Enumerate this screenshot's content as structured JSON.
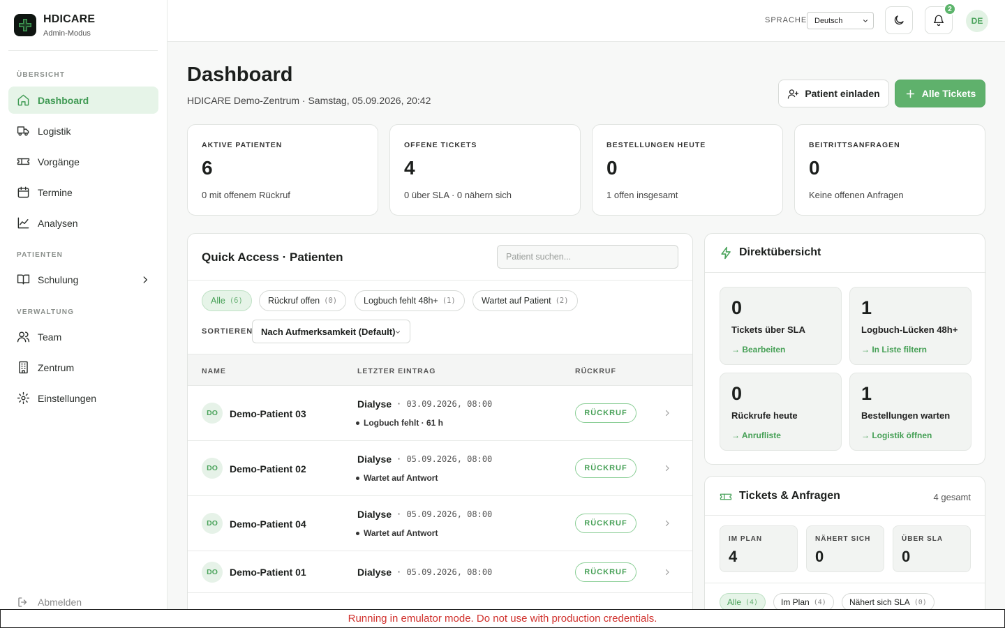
{
  "brand": {
    "title": "HDICARE",
    "subtitle": "Admin-Modus"
  },
  "sidebar": {
    "sections": [
      "ÜBERSICHT",
      "PATIENTEN",
      "VERWALTUNG"
    ],
    "items": [
      {
        "label": "Dashboard",
        "icon": "home-icon",
        "active": true
      },
      {
        "label": "Logistik",
        "icon": "truck-icon"
      },
      {
        "label": "Vorgänge",
        "icon": "ticket-icon"
      },
      {
        "label": "Termine",
        "icon": "calendar-icon"
      },
      {
        "label": "Analysen",
        "icon": "chart-line-icon"
      },
      {
        "label": "Schulung",
        "icon": "book-icon"
      },
      {
        "label": "Team",
        "icon": "users-icon"
      },
      {
        "label": "Zentrum",
        "icon": "building-icon"
      },
      {
        "label": "Einstellungen",
        "icon": "gear-icon"
      }
    ],
    "logout": "Abmelden"
  },
  "topbar": {
    "language_label": "SPRACHE",
    "language_value": "Deutsch",
    "notifications_count": "2",
    "avatar": "DE"
  },
  "header": {
    "title": "Dashboard",
    "subtitle": "HDICARE Demo-Zentrum · Samstag, 05.09.2026, 20:42",
    "invite_label": "Patient einladen",
    "all_tickets_label": "Alle Tickets"
  },
  "stats": [
    {
      "label": "AKTIVE PATIENTEN",
      "value": "6",
      "hint": "0 mit offenem Rückruf"
    },
    {
      "label": "OFFENE TICKETS",
      "value": "4",
      "hint": "0 über SLA · 0 nähern sich"
    },
    {
      "label": "BESTELLUNGEN HEUTE",
      "value": "0",
      "hint": "1 offen insgesamt"
    },
    {
      "label": "BEITRITTSANFRAGEN",
      "value": "0",
      "hint": "Keine offenen Anfragen"
    }
  ],
  "quick_access": {
    "title": "Quick Access · Patienten",
    "search_placeholder": "Patient suchen...",
    "filters": [
      {
        "label": "Alle",
        "count": "(6)"
      },
      {
        "label": "Rückruf offen",
        "count": "(0)"
      },
      {
        "label": "Logbuch fehlt 48h+",
        "count": "(1)"
      },
      {
        "label": "Wartet auf Patient",
        "count": "(2)"
      }
    ],
    "sort_label": "SORTIEREN",
    "sort_value": "Nach Aufmerksamkeit (Default)",
    "columns": [
      "NAME",
      "LETZTER EINTRAG",
      "RÜCKRUF"
    ],
    "rows": [
      {
        "initials": "DO",
        "name": "Demo-Patient 03",
        "type": "Dialyse",
        "date": "· 03.09.2026, 08:00",
        "status": "Logbuch fehlt · 61 h",
        "action": "RÜCKRUF"
      },
      {
        "initials": "DO",
        "name": "Demo-Patient 02",
        "type": "Dialyse",
        "date": "· 05.09.2026, 08:00",
        "status": "Wartet auf Antwort",
        "action": "RÜCKRUF"
      },
      {
        "initials": "DO",
        "name": "Demo-Patient 04",
        "type": "Dialyse",
        "date": "· 05.09.2026, 08:00",
        "status": "Wartet auf Antwort",
        "action": "RÜCKRUF"
      },
      {
        "initials": "DO",
        "name": "Demo-Patient 01",
        "type": "Dialyse",
        "date": "· 05.09.2026, 08:00",
        "status": "",
        "action": "RÜCKRUF"
      }
    ]
  },
  "direct": {
    "title": "Direktübersicht",
    "tiles": [
      {
        "value": "0",
        "label": "Tickets über SLA",
        "action": "→ Bearbeiten"
      },
      {
        "value": "1",
        "label": "Logbuch-Lücken 48h+",
        "action": "→ In Liste filtern"
      },
      {
        "value": "0",
        "label": "Rückrufe heute",
        "action": "→ Anrufliste"
      },
      {
        "value": "1",
        "label": "Bestellungen warten",
        "action": "→ Logistik öffnen"
      }
    ]
  },
  "tickets": {
    "title": "Tickets & Anfragen",
    "total": "4 gesamt",
    "metrics": [
      {
        "label": "IM PLAN",
        "value": "4"
      },
      {
        "label": "NÄHERT SICH",
        "value": "0"
      },
      {
        "label": "ÜBER SLA",
        "value": "0"
      }
    ],
    "filters": [
      {
        "label": "Alle",
        "count": "(4)"
      },
      {
        "label": "Im Plan",
        "count": "(4)"
      },
      {
        "label": "Nähert sich SLA",
        "count": "(0)"
      }
    ]
  },
  "emulator_notice": "Running in emulator mode. Do not use with production credentials.",
  "colors": {
    "accent": "#5fb16c",
    "accent_light": "#e6f4e8",
    "warning_text": "#d0312d"
  }
}
